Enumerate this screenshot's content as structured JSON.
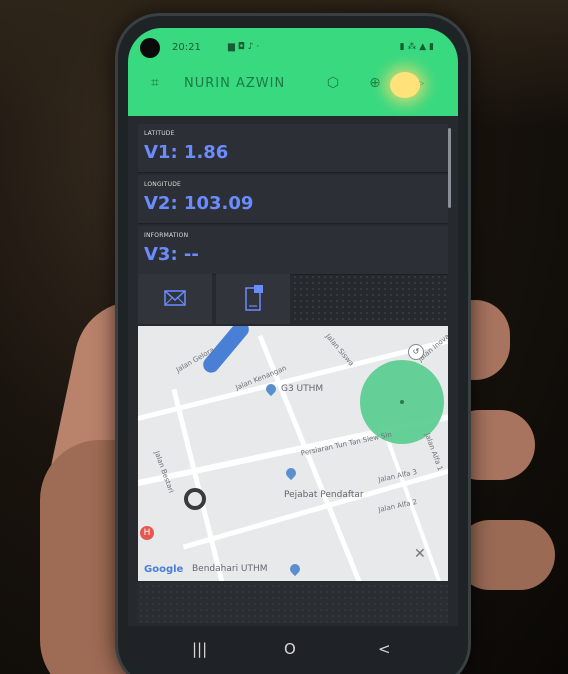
{
  "statusbar": {
    "time": "20:21",
    "left_icons": "▆ ◘ ♪ ·",
    "right_icons": "▮ ⁂ ▲ ▮"
  },
  "app": {
    "project_title": "NURIN AZWIN"
  },
  "widgets": [
    {
      "label": "LATITUDE",
      "value": "V1: 1.86"
    },
    {
      "label": "LONGITUDE",
      "value": "V2: 103.09"
    },
    {
      "label": "INFORMATION",
      "value": "V3: --"
    }
  ],
  "map": {
    "places": [
      "G3 UTHM",
      "Pejabat Pendaftar",
      "Bendahari UTHM"
    ],
    "streets": [
      "Jalan Kenangan",
      "Jalan Gelora",
      "Jalan Siswa",
      "Persiaran Tun Tan Siew Sin",
      "Jalan Alfa 3",
      "Jalan Alfa 1",
      "Jalan Alfa 2",
      "Jalan Bestari",
      "Jalan Inovasi"
    ],
    "logo": "Google"
  },
  "nav": {
    "recents": "|||",
    "home": "O",
    "back": "<"
  },
  "colors": {
    "accent": "#39d980",
    "value_text": "#6b8cff",
    "geofence": "#59cc8f"
  }
}
